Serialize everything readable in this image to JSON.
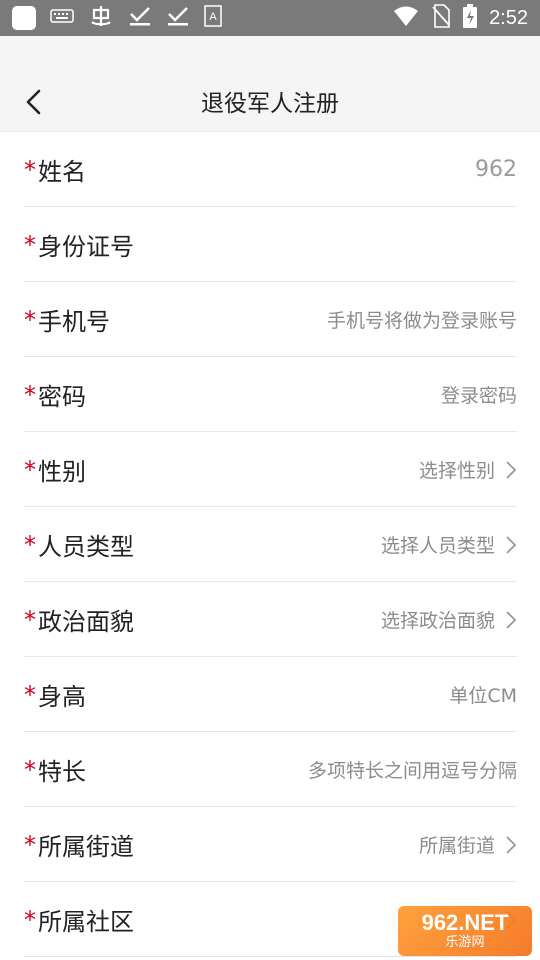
{
  "status_bar": {
    "time": "2:52",
    "icons": [
      "app-icon",
      "keyboard-icon",
      "bug-icon",
      "check-icon",
      "check-icon",
      "font-icon",
      "wifi-icon",
      "no-sim-icon",
      "battery-icon"
    ]
  },
  "header": {
    "title": "退役军人注册",
    "back_icon": "chevron-left-icon"
  },
  "form": {
    "required_mark": "*",
    "rows": [
      {
        "label": "姓名",
        "value": "962",
        "chevron": false
      },
      {
        "label": "身份证号",
        "value": "",
        "chevron": false
      },
      {
        "label": "手机号",
        "value": "手机号将做为登录账号",
        "chevron": false
      },
      {
        "label": "密码",
        "value": "登录密码",
        "chevron": false
      },
      {
        "label": "性别",
        "value": "选择性别",
        "chevron": true
      },
      {
        "label": "人员类型",
        "value": "选择人员类型",
        "chevron": true
      },
      {
        "label": "政治面貌",
        "value": "选择政治面貌",
        "chevron": true
      },
      {
        "label": "身高",
        "value": "单位CM",
        "chevron": false
      },
      {
        "label": "特长",
        "value": "多项特长之间用逗号分隔",
        "chevron": false
      },
      {
        "label": "所属街道",
        "value": "所属街道",
        "chevron": true
      },
      {
        "label": "所属社区",
        "value": "",
        "chevron": true
      }
    ]
  },
  "watermark": {
    "line1": "962.NET",
    "line2": "乐游网"
  }
}
